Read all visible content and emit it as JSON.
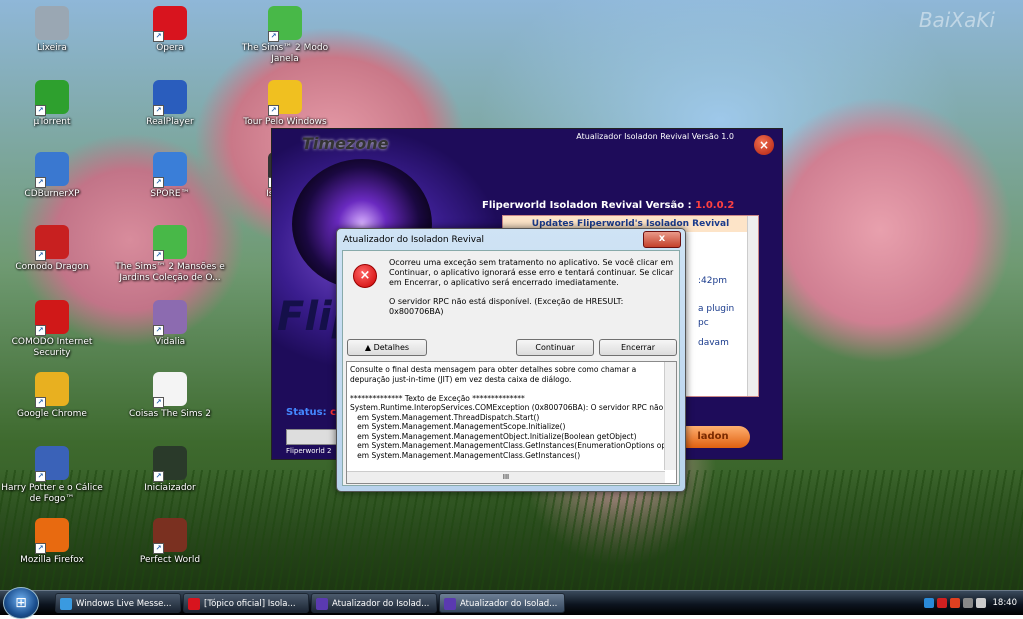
{
  "watermark": "BaiXaKi",
  "desktop_icons": [
    {
      "label": "Lixeira",
      "icon": "recycle-bin-icon",
      "color": "#9aa7b3"
    },
    {
      "label": "Opera",
      "icon": "opera-icon",
      "color": "#d8141e"
    },
    {
      "label": "The Sims™ 2 Modo Janela",
      "icon": "sims-plumbob-icon",
      "color": "#48b848"
    },
    {
      "label": "µTorrent",
      "icon": "utorrent-icon",
      "color": "#2ea02e"
    },
    {
      "label": "RealPlayer",
      "icon": "realplayer-icon",
      "color": "#2a5dbd"
    },
    {
      "label": "Tour Pelo Windows",
      "icon": "star-icon",
      "color": "#f0c020"
    },
    {
      "label": "CDBurnerXP",
      "icon": "cdburner-icon",
      "color": "#3a78d0"
    },
    {
      "label": "SPORE™",
      "icon": "spore-icon",
      "color": "#3a7ed8"
    },
    {
      "label": "Isoladon",
      "icon": "isoladon-icon",
      "color": "#333"
    },
    {
      "label": "Comodo Dragon",
      "icon": "comodo-dragon-icon",
      "color": "#c82020"
    },
    {
      "label": "The Sims™ 2 Mansões e Jardins Coleção de O...",
      "icon": "sims-plumbob-icon",
      "color": "#48b848"
    },
    {
      "label": "COMODO Internet Security",
      "icon": "comodo-shield-icon",
      "color": "#d01818"
    },
    {
      "label": "Vidalia",
      "icon": "onion-icon",
      "color": "#8c6bb0"
    },
    {
      "label": "Google Chrome",
      "icon": "chrome-icon",
      "color": "#e8b020"
    },
    {
      "label": "Coisas The Sims 2",
      "icon": "document-icon",
      "color": "#f4f4f4"
    },
    {
      "label": "Harry Potter e o Cálice de Fogo™",
      "icon": "harry-potter-icon",
      "color": "#3a62b8"
    },
    {
      "label": "Iniciaizador",
      "icon": "game-launcher-icon",
      "color": "#2a3a2a"
    },
    {
      "label": "Mozilla Firefox",
      "icon": "firefox-icon",
      "color": "#e86a10"
    },
    {
      "label": "Perfect World",
      "icon": "perfect-world-icon",
      "color": "#7a3020"
    }
  ],
  "app_window": {
    "title": "Atualizador Isoladon Revival Versão 1.0",
    "logo_text": "Timezone",
    "big_word": "Fliper",
    "version_label": "Fliperworld Isoladon Revival Versão :",
    "version_value": "1.0.0.2",
    "panel_header": "Updates Fliperworld's Isoladon Revival",
    "panel_lines": [
      ":42pm",
      "a plugin",
      "pc",
      "davam"
    ],
    "status_label": "Status:",
    "status_value": "c",
    "footer": "Fliperworld 2",
    "button_label": "ladon"
  },
  "dialog": {
    "title": "Atualizador do Isoladon Revival",
    "close_label": "x",
    "message_1": "Ocorreu uma exceção sem tratamento no aplicativo. Se você clicar em Continuar, o aplicativo ignorará esse erro e tentará continuar. Se clicar em Encerrar, o aplicativo será encerrado imediatamente.",
    "message_2": "O servidor RPC não está disponível. (Exceção de HRESULT: 0x800706BA)",
    "details_button": "▲ Detalhes",
    "continue_button": "Continuar",
    "quit_button": "Encerrar",
    "details_text": "Consulte o final desta mensagem para obter detalhes sobre como chamar a\ndepuração just-in-time (JIT) em vez desta caixa de diálogo.\n\n************** Texto de Exceção **************\nSystem.Runtime.InteropServices.COMException (0x800706BA): O servidor RPC não\n   em System.Management.ThreadDispatch.Start()\n   em System.Management.ManagementScope.Initialize()\n   em System.Management.ManagementObject.Initialize(Boolean getObject)\n   em System.Management.ManagementClass.GetInstances(EnumerationOptions op\n   em System.Management.ManagementClass.GetInstances()",
    "hscroll_thumb": "III"
  },
  "taskbar": {
    "tasks": [
      {
        "label": "Windows Live Messe...",
        "icon": "messenger-icon",
        "color": "#3a9ae0"
      },
      {
        "label": "[Tópico oficial] Isola...",
        "icon": "opera-icon",
        "color": "#d8141e"
      },
      {
        "label": "Atualizador do Isolad...",
        "icon": "isoladon-icon",
        "color": "#5a3ab0"
      },
      {
        "label": "Atualizador do Isolad...",
        "icon": "isoladon-icon",
        "color": "#5a3ab0"
      }
    ],
    "clock": "18:40",
    "tray_icons": [
      "network-icon",
      "comodo-icon",
      "security-icon",
      "display-icon",
      "volume-icon"
    ]
  }
}
